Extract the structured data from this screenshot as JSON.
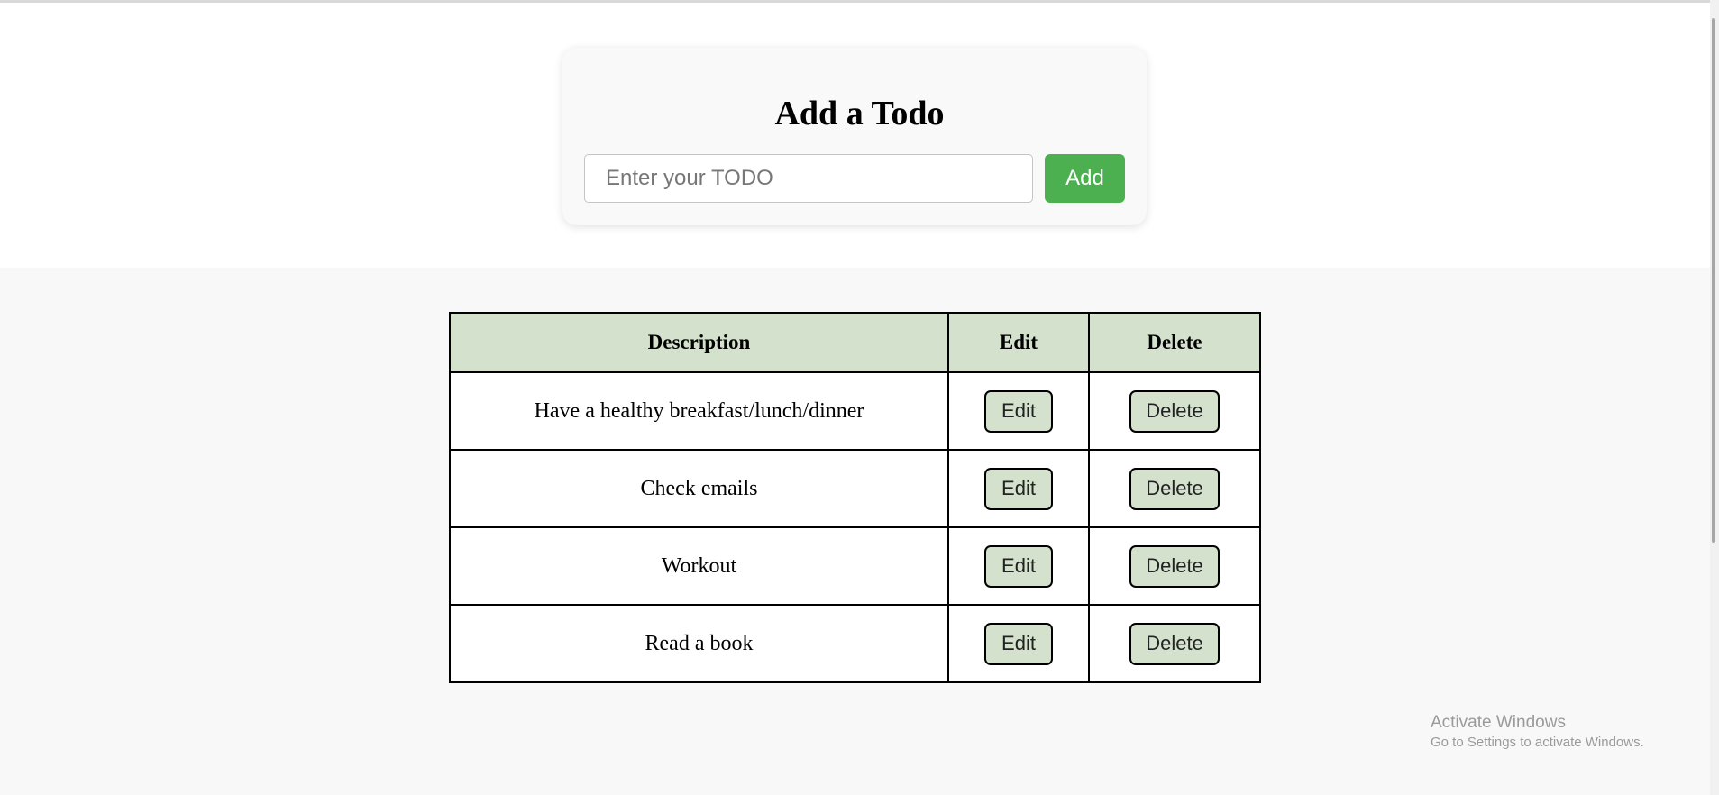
{
  "form": {
    "title": "Add a Todo",
    "input_placeholder": "Enter your TODO",
    "input_value": "",
    "add_label": "Add"
  },
  "table": {
    "headers": {
      "description": "Description",
      "edit": "Edit",
      "delete": "Delete"
    },
    "rows": [
      {
        "description": "Have a healthy breakfast/lunch/dinner",
        "edit_label": "Edit",
        "delete_label": "Delete"
      },
      {
        "description": "Check emails",
        "edit_label": "Edit",
        "delete_label": "Delete"
      },
      {
        "description": "Workout",
        "edit_label": "Edit",
        "delete_label": "Delete"
      },
      {
        "description": "Read a book",
        "edit_label": "Edit",
        "delete_label": "Delete"
      }
    ]
  },
  "watermark": {
    "title": "Activate Windows",
    "subtitle": "Go to Settings to activate Windows."
  },
  "colors": {
    "accent_green": "#4caf50",
    "table_header_bg": "#d3e1cd",
    "row_button_bg": "#d3e1cd",
    "page_bg": "#f8f8f8"
  }
}
